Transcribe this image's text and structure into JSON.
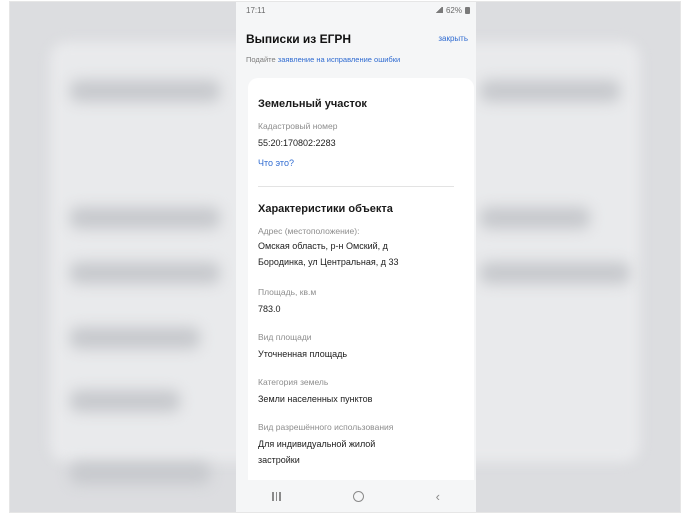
{
  "status_bar": {
    "time": "17:11",
    "battery": "62%"
  },
  "header": {
    "title": "Выписки из ЕГРН",
    "close_label": "закрыть"
  },
  "hint": {
    "prefix": "Подайте",
    "link": "заявление на исправление ошибки"
  },
  "section_land": {
    "title": "Земельный участок",
    "cadastral_label": "Кадастровый номер",
    "cadastral_value": "55:20:170802:2283",
    "what_link": "Что это?"
  },
  "section_char": {
    "title": "Характеристики объекта",
    "address_label": "Адрес (местоположение):",
    "address_line1": "Омская область, р-н Омский, д",
    "address_line2": "Бородинка, ул Центральная, д 33",
    "area_label": "Площадь, кв.м",
    "area_value": "783.0",
    "area_type_label": "Вид площади",
    "area_type_value": "Уточненная площадь",
    "category_label": "Категория земель",
    "category_value": "Земли населенных пунктов",
    "usage_label": "Вид разрешённого использования",
    "usage_line1": "Для индивидуальной жилой",
    "usage_line2": "застройки"
  }
}
